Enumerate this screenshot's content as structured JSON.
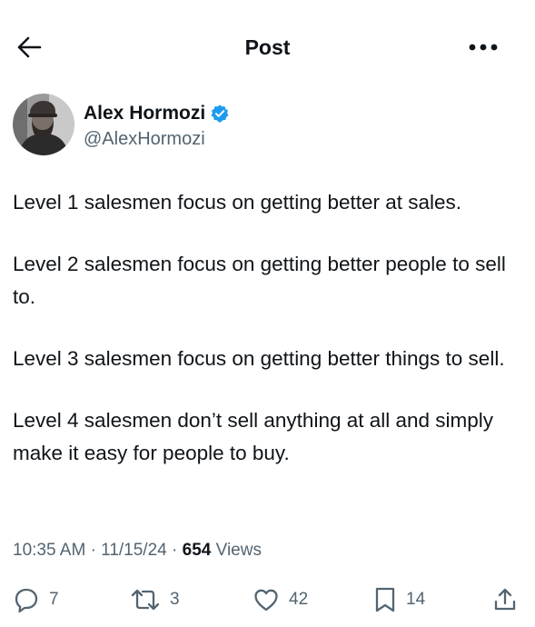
{
  "header": {
    "title": "Post",
    "back_icon": "arrow-left-icon",
    "more_icon": "more-dots-icon"
  },
  "author": {
    "name": "Alex Hormozi",
    "handle": "@AlexHormozi",
    "verified": true,
    "verified_color": "#1d9bf0"
  },
  "post": {
    "paragraphs": [
      "Level 1 salesmen focus on getting better at sales.",
      "Level 2 salesmen focus on getting better people to sell to.",
      "Level 3 salesmen focus on getting better things to sell.",
      "Level 4 salesmen don’t sell anything at all and simply make it easy for people to buy."
    ]
  },
  "meta": {
    "time": "10:35 AM",
    "separator": "·",
    "date": "11/15/24",
    "views_count": "654",
    "views_label": "Views"
  },
  "actions": {
    "replies": "7",
    "reposts": "3",
    "likes": "42",
    "bookmarks": "14"
  },
  "colors": {
    "text": "#0f1419",
    "secondary": "#536471",
    "accent": "#1d9bf0"
  }
}
